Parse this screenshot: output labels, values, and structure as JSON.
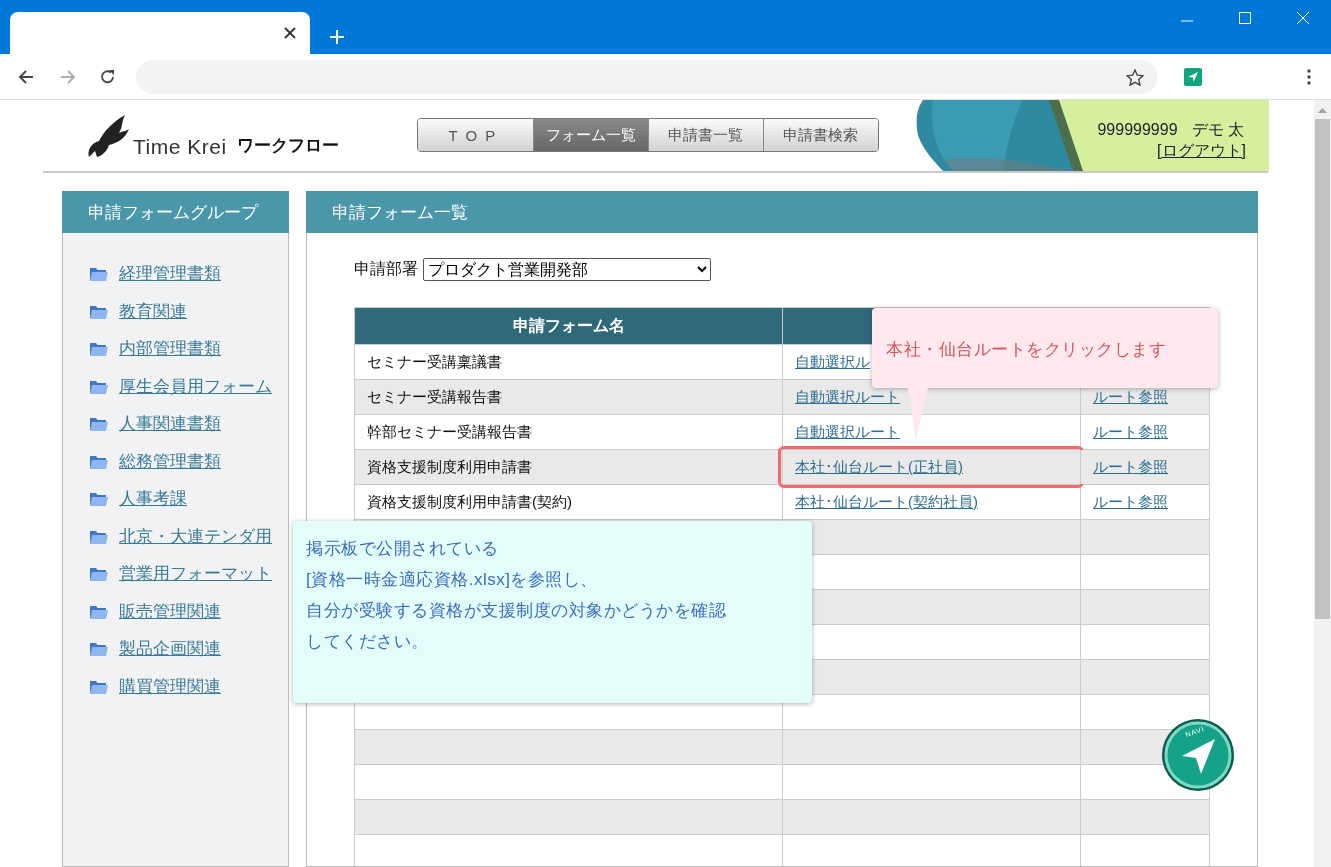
{
  "header": {
    "logo_text": "Time Krei",
    "logo_sub": "ワークフロー",
    "nav": [
      {
        "label": "TOP",
        "selected": false
      },
      {
        "label": "フォーム一覧",
        "selected": true
      },
      {
        "label": "申請書一覧",
        "selected": false
      },
      {
        "label": "申請書検索",
        "selected": false
      }
    ],
    "user_id": "999999999",
    "user_name": "デモ 太",
    "logout": "[ログアウト]"
  },
  "sidebar": {
    "title": "申請フォームグループ",
    "items": [
      "経理管理書類",
      "教育関連",
      "内部管理書類",
      "厚生会員用フォーム",
      "人事関連書類",
      "総務管理書類",
      "人事考課",
      "北京・大連テンダ用",
      "営業用フォーマット",
      "販売管理関連",
      "製品企画関連",
      "購買管理関連"
    ]
  },
  "main": {
    "title": "申請フォーム一覧",
    "department_label": "申請部署",
    "department": "プロダクト営業開発部",
    "table": {
      "columns": [
        "申請フォーム名"
      ],
      "rows": [
        {
          "cells": [
            "セミナー受講稟議書",
            "自動選択ル"
          ],
          "highlighted": false
        },
        {
          "cells": [
            "セミナー受講報告書",
            "自動選択ルート",
            "ルート参照"
          ],
          "highlighted": false
        },
        {
          "cells": [
            "幹部セミナー受講報告書",
            "自動選択ルート",
            "ルート参照"
          ],
          "highlighted": false
        },
        {
          "cells": [
            "資格支援制度利用申請書",
            "本社･仙台ルート(正社員)",
            "ルート参照"
          ],
          "highlighted": true
        },
        {
          "cells": [
            "資格支援制度利用申請書(契約)",
            "本社･仙台ルート(契約社員)",
            "ルート参照"
          ],
          "highlighted": false
        }
      ]
    }
  },
  "callouts": [
    {
      "kind": "tip",
      "text": "本社・仙台ルートをクリックします"
    },
    {
      "kind": "note",
      "lines": [
        "掲示板で公開されている",
        "[資格一時金適応資格.xlsx]を参照し、",
        "自分が受験する資格が支援制度の対象かどうかを確認",
        "してください。"
      ]
    }
  ],
  "navi": {
    "label": "NAVI"
  }
}
